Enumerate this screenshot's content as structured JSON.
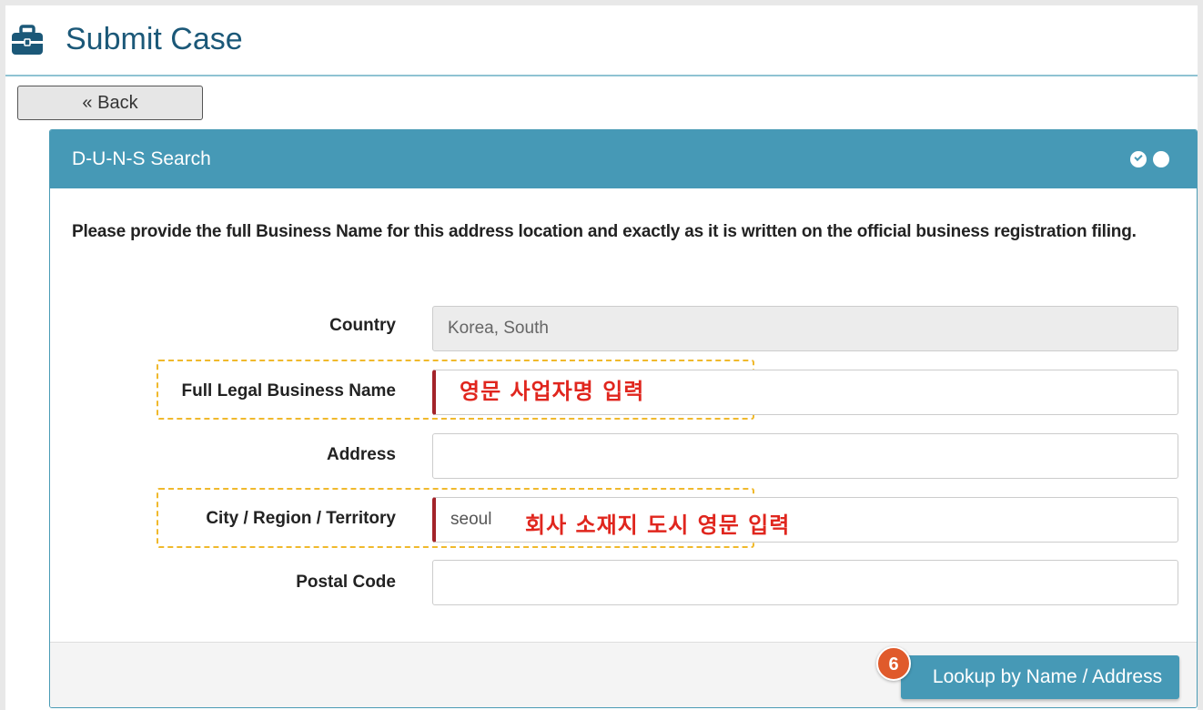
{
  "header": {
    "title": "Submit Case",
    "icon": "briefcase-icon"
  },
  "back_button": {
    "label": "« Back"
  },
  "panel": {
    "title": "D-U-N-S Search",
    "steps": {
      "total": 2,
      "completed": 1
    }
  },
  "instructions": "Please provide the full Business Name for this address location and exactly as it is written on the official business registration filing.",
  "form": {
    "country": {
      "label": "Country",
      "value": "Korea, South"
    },
    "business_name": {
      "label": "Full Legal Business Name",
      "value": ""
    },
    "address": {
      "label": "Address",
      "value": ""
    },
    "city": {
      "label": "City / Region / Territory",
      "value": "seoul"
    },
    "postal_code": {
      "label": "Postal Code",
      "value": ""
    }
  },
  "annotations": {
    "business_name_hint": "영문 사업자명 입력",
    "city_hint": "회사 소재지 도시 영문 입력",
    "step_badge": "6"
  },
  "footer": {
    "lookup_label": "Lookup by Name / Address"
  },
  "colors": {
    "accent": "#4699b6",
    "title": "#1b5878",
    "required": "#a3232a",
    "annotation": "#e0261e",
    "highlight": "#f0b92c",
    "badge": "#e05a2b"
  }
}
